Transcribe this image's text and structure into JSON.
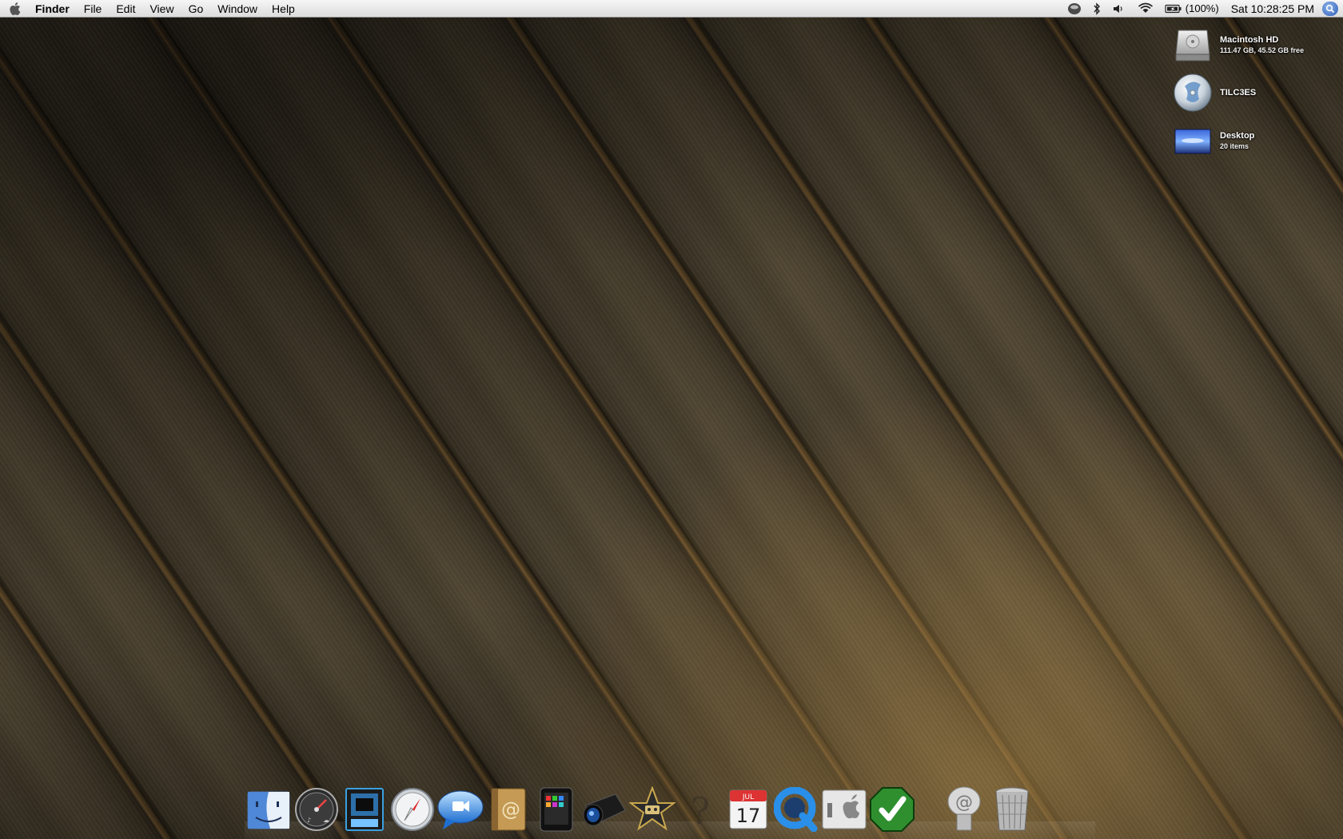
{
  "menubar": {
    "apple_icon": "apple-logo-icon",
    "app_name": "Finder",
    "menus": [
      "File",
      "Edit",
      "View",
      "Go",
      "Window",
      "Help"
    ],
    "status": {
      "battery_percent": "(100%)",
      "clock": "Sat 10:28:25 PM"
    }
  },
  "desktop": {
    "items": [
      {
        "title": "Macintosh HD",
        "subtitle": "111.47 GB, 45.52 GB free",
        "icon": "hard-drive-icon"
      },
      {
        "title": "TILC3ES",
        "subtitle": "",
        "icon": "disc-icon"
      },
      {
        "title": "Desktop",
        "subtitle": "20 items",
        "icon": "folder-icon"
      }
    ]
  },
  "dock": {
    "calendar": {
      "month": "JUL",
      "day": "17"
    },
    "items": [
      "finder-icon",
      "dashboard-icon",
      "photo-booth-icon",
      "safari-icon",
      "ichat-icon",
      "address-book-icon",
      "ipod-icon",
      "aperture-icon",
      "imovie-icon",
      "help-icon",
      "ical-icon",
      "quicktime-icon",
      "system-info-icon",
      "check-icon",
      "mail-icon",
      "trash-icon"
    ]
  },
  "colors": {
    "menubar": "#e6e6e6",
    "wood": "#4a4130",
    "spotlight": "#2b5bb5"
  }
}
